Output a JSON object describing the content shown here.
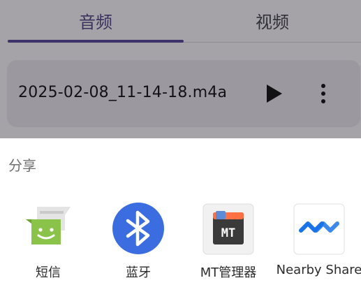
{
  "tabs": [
    {
      "label": "音频",
      "selected": true
    },
    {
      "label": "视频",
      "selected": false
    }
  ],
  "file_item": {
    "name": "2025-02-08_11-14-18.m4a",
    "play_icon": "play-icon",
    "more_icon": "more-vert-icon"
  },
  "share_sheet": {
    "title": "分享",
    "targets": [
      {
        "label": "短信",
        "icon": "messages-app-icon"
      },
      {
        "label": "蓝牙",
        "icon": "bluetooth-icon"
      },
      {
        "label": "MT管理器",
        "icon": "mt-manager-icon"
      },
      {
        "label": "Nearby Share",
        "icon": "nearby-share-icon"
      }
    ]
  },
  "colors": {
    "accent": "#5a4ea0",
    "bluetooth": "#3c6de0",
    "messages": "#8bc34a",
    "nearby": "#1a73e8"
  }
}
